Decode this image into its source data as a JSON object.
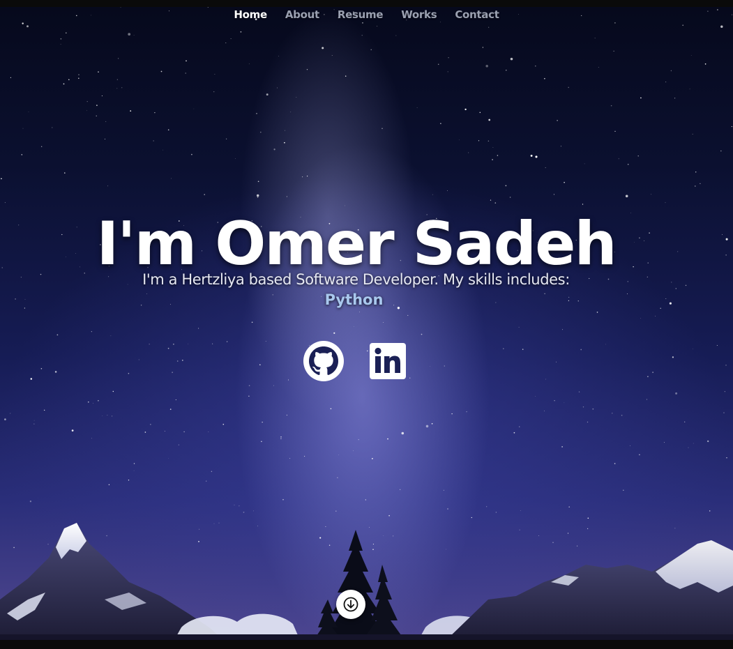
{
  "nav": {
    "items": [
      {
        "label": "Home",
        "active": true
      },
      {
        "label": "About",
        "active": false
      },
      {
        "label": "Resume",
        "active": false
      },
      {
        "label": "Works",
        "active": false
      },
      {
        "label": "Contact",
        "active": false
      }
    ]
  },
  "hero": {
    "title": "I'm Omer Sadeh",
    "subtitle": "I'm a Hertzliya based Software Developer. My skills includes:",
    "skill": "Python"
  },
  "social": {
    "icons": [
      "github-icon",
      "linkedin-icon"
    ]
  },
  "scroll": {
    "icon": "arrow-down-icon"
  },
  "colors": {
    "accent": "#a9c8ee",
    "nav_inactive": "#9aa0b0",
    "nav_active": "#ffffff"
  }
}
